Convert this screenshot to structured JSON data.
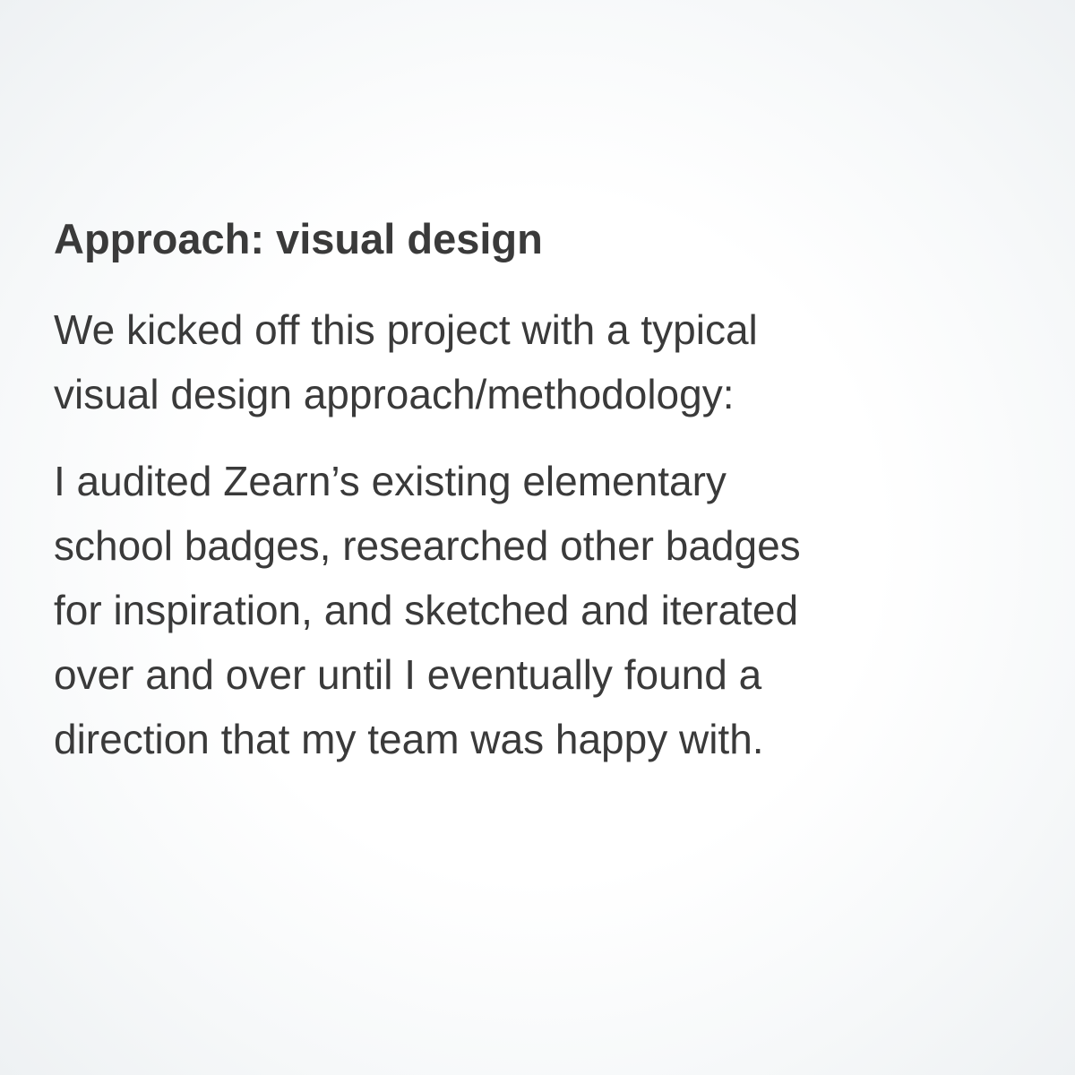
{
  "heading": "Approach: visual design",
  "paragraphs": [
    {
      "lines": [
        "We kicked off this project with a typical",
        "visual design approach/methodology:"
      ]
    },
    {
      "lines": [
        "I audited Zearn’s existing elementary",
        "school badges, researched other badges",
        "for inspiration, and sketched and iterated",
        "over and over until I eventually found a",
        "direction that my team was happy with."
      ]
    }
  ]
}
